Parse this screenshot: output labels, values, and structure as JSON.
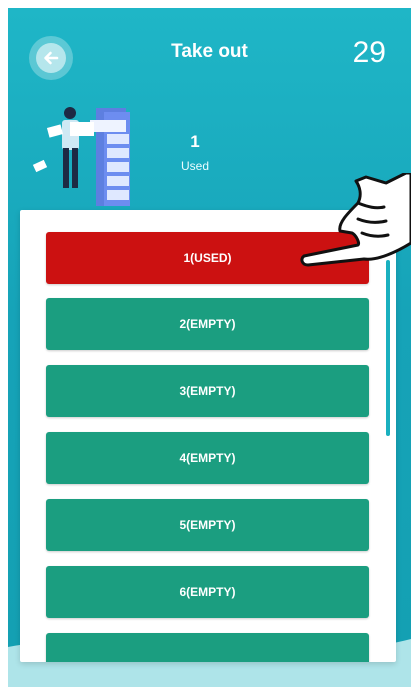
{
  "header": {
    "title": "Take out",
    "counter": "29",
    "back_icon": "arrow-left-icon"
  },
  "summary": {
    "used_count": "1",
    "used_label": "Used"
  },
  "slots": [
    {
      "label": "1(USED)",
      "status": "used"
    },
    {
      "label": "2(EMPTY)",
      "status": "empty"
    },
    {
      "label": "3(EMPTY)",
      "status": "empty"
    },
    {
      "label": "4(EMPTY)",
      "status": "empty"
    },
    {
      "label": "5(EMPTY)",
      "status": "empty"
    },
    {
      "label": "6(EMPTY)",
      "status": "empty"
    },
    {
      "label": "",
      "status": "empty"
    }
  ],
  "colors": {
    "background": "#16a3b8",
    "used": "#cc1111",
    "empty": "#1b9e80",
    "text": "#ffffff"
  }
}
